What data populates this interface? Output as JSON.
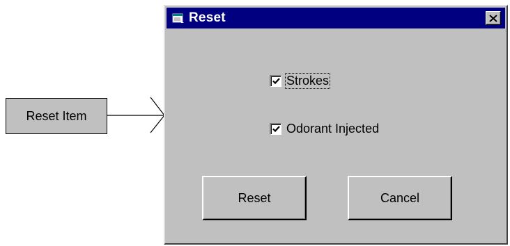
{
  "callout": {
    "label": "Reset Item"
  },
  "dialog": {
    "title": "Reset",
    "close_glyph": "✕",
    "title_bar_color": "#000080",
    "face_color": "#c0c0c0"
  },
  "options": [
    {
      "label": "Strokes",
      "checked": true
    },
    {
      "label": "Odorant Injected",
      "checked": true
    }
  ],
  "buttons": {
    "reset_label": "Reset",
    "cancel_label": "Cancel"
  },
  "icons": {
    "app": "app-window-icon",
    "close": "close-icon",
    "check": "checkmark-icon",
    "arrow": "arrow-icon"
  }
}
